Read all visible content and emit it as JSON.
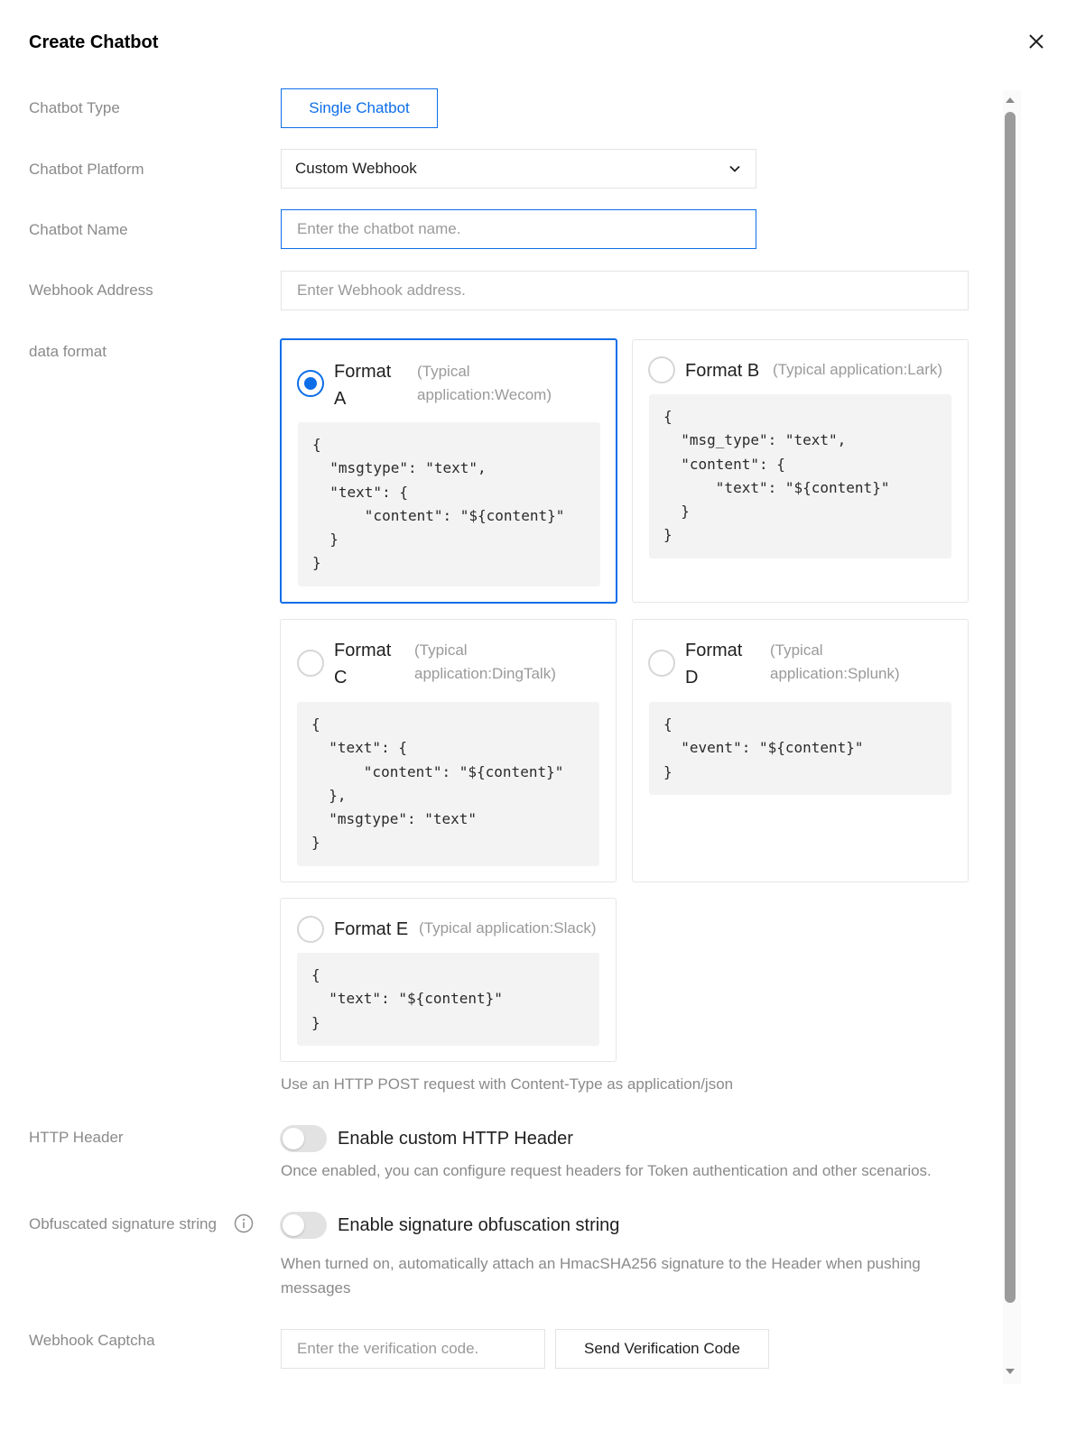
{
  "dialog": {
    "title": "Create Chatbot"
  },
  "form": {
    "chatbot_type": {
      "label": "Chatbot Type",
      "value": "Single Chatbot"
    },
    "platform": {
      "label": "Chatbot Platform",
      "value": "Custom Webhook"
    },
    "name": {
      "label": "Chatbot Name",
      "placeholder": "Enter the chatbot name.",
      "value": ""
    },
    "webhook": {
      "label": "Webhook Address",
      "placeholder": "Enter Webhook address.",
      "value": ""
    },
    "data_format": {
      "label": "data format",
      "selected": "Format A",
      "options": [
        {
          "name": "Format A",
          "desc": "(Typical application:Wecom)",
          "code": "{\n  \"msgtype\": \"text\",\n  \"text\": {\n      \"content\": \"${content}\"\n  }\n}"
        },
        {
          "name": "Format B",
          "desc": "(Typical application:Lark)",
          "code": "{\n  \"msg_type\": \"text\",\n  \"content\": {\n      \"text\": \"${content}\"\n  }\n}"
        },
        {
          "name": "Format C",
          "desc": "(Typical application:DingTalk)",
          "code": "{\n  \"text\": {\n      \"content\": \"${content}\"\n  },\n  \"msgtype\": \"text\"\n}"
        },
        {
          "name": "Format D",
          "desc": "(Typical application:Splunk)",
          "code": "{\n  \"event\": \"${content}\"\n}"
        },
        {
          "name": "Format E",
          "desc": "(Typical application:Slack)",
          "code": "{\n  \"text\": \"${content}\"\n}"
        }
      ],
      "hint": "Use an HTTP POST request with Content-Type as application/json"
    },
    "http_header": {
      "label": "HTTP Header",
      "toggle_label": "Enable custom HTTP Header",
      "enabled": false,
      "hint": "Once enabled, you can configure request headers for Token authentication and other scenarios."
    },
    "signature": {
      "label": "Obfuscated signature string",
      "toggle_label": "Enable signature obfuscation string",
      "enabled": false,
      "hint": "When turned on, automatically attach an HmacSHA256 signature to the Header when pushing messages"
    },
    "captcha": {
      "label": "Webhook Captcha",
      "placeholder": "Enter the verification code.",
      "value": "",
      "send_button": "Send Verification Code"
    }
  },
  "icons": {
    "close": "close-icon",
    "dropdown": "chevron-down-icon",
    "info": "info-icon",
    "scroll_up": "triangle-up-icon",
    "scroll_down": "triangle-down-icon"
  },
  "colors": {
    "accent": "#0d6ee8",
    "label": "#8a8a8a",
    "code_bg": "#f3f3f3",
    "toggle_off": "#e2e2e2"
  }
}
